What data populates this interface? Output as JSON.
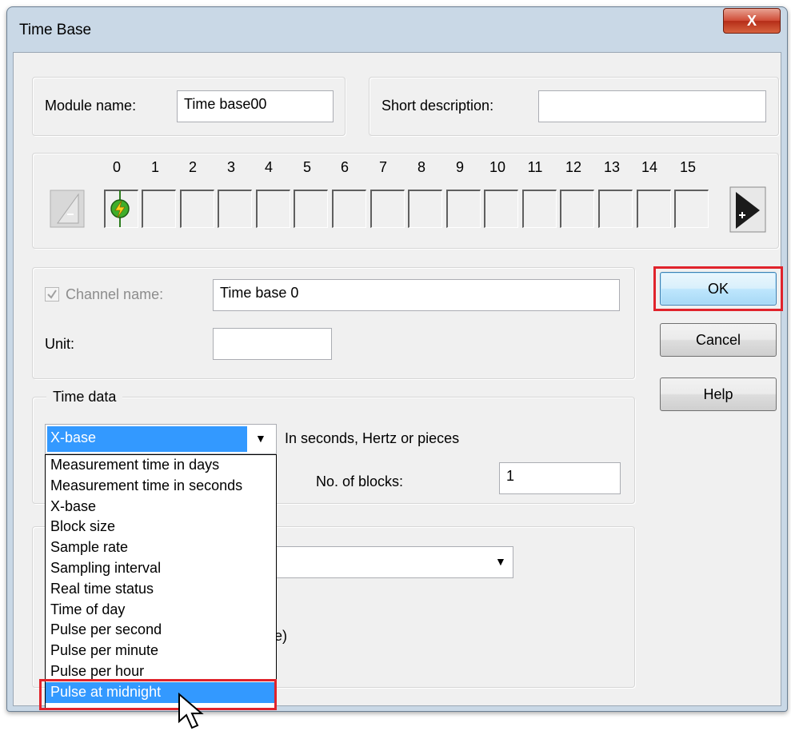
{
  "window": {
    "title": "Time Base",
    "close_glyph": "X"
  },
  "module": {
    "name_label": "Module name:",
    "name_value": "Time base00",
    "short_desc_label": "Short description:",
    "short_desc_value": ""
  },
  "channels": {
    "numbers": [
      "0",
      "1",
      "2",
      "3",
      "4",
      "5",
      "6",
      "7",
      "8",
      "9",
      "10",
      "11",
      "12",
      "13",
      "14",
      "15"
    ],
    "active_channel": "0",
    "prev_icon": "arrow-left-minus-icon",
    "next_icon": "arrow-right-plus-icon",
    "active_icon": "lightning-plug-icon"
  },
  "channel": {
    "name_label": "Channel name:",
    "name_checked": true,
    "name_value": "Time base 0",
    "unit_label": "Unit:",
    "unit_value": ""
  },
  "buttons": {
    "ok": "OK",
    "cancel": "Cancel",
    "help": "Help"
  },
  "time_data": {
    "group_label": "Time data",
    "selected": "X-base",
    "hint": "In seconds, Hertz or pieces",
    "blocks_label": "No. of blocks:",
    "blocks_value": "1",
    "options": [
      "Measurement time in days",
      "Measurement time in seconds",
      "X-base",
      "Block size",
      "Sample rate",
      "Sampling interval",
      "Real time status",
      "Time of day",
      "Pulse per second",
      "Pulse per minute",
      "Pulse per hour",
      "Pulse at midnight"
    ],
    "highlighted_option": "Pulse at midnight"
  },
  "lower_group": {
    "partial_text": "te)"
  },
  "colors": {
    "highlight_red": "#e0232b",
    "selection_blue": "#3399ff"
  }
}
